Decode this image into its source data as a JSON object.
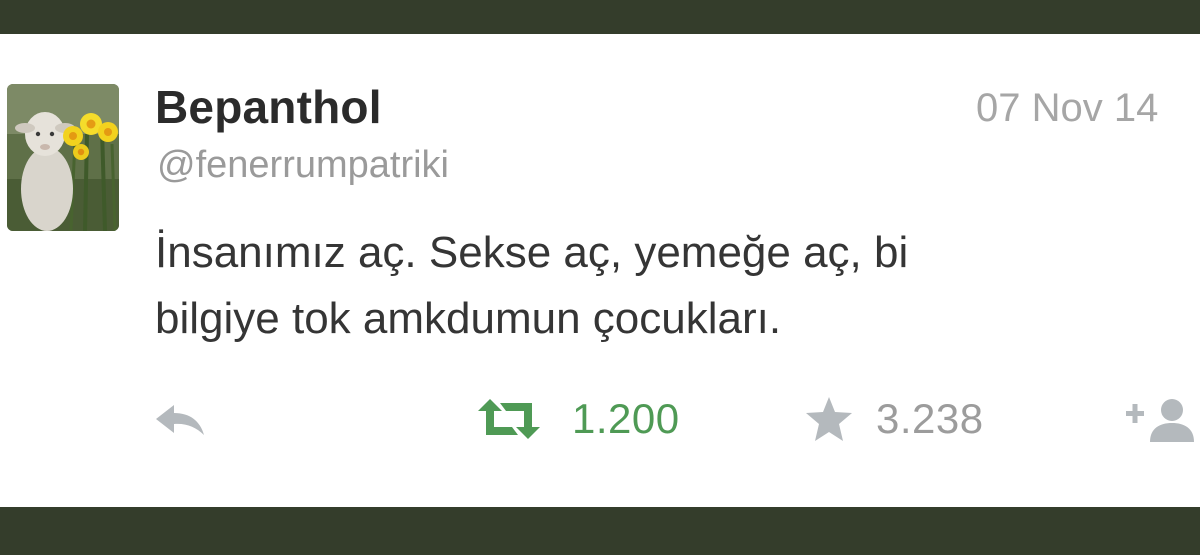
{
  "tweet": {
    "author": {
      "display_name": "Bepanthol",
      "handle": "@fenerrumpatriki",
      "avatar": "lamb-with-daffodils-avatar"
    },
    "timestamp": "07 Nov 14",
    "text_line1": "İnsanımız aç. Sekse aç, yemeğe aç, bi",
    "text_line2": "bilgiye tok amkdumun çocukları.",
    "actions": {
      "reply_icon": "reply-icon",
      "retweet_icon": "retweet-icon",
      "retweet_count": "1.200",
      "favorite_icon": "star-icon",
      "favorite_count": "3.238",
      "follow_icon": "add-user-icon"
    }
  },
  "colors": {
    "frame": "#343d2b",
    "card": "#ffffff",
    "name": "#2b2b2b",
    "muted": "#9a9a9a",
    "retweet_green": "#4f9a55",
    "icon_gray": "#b4b9bd"
  }
}
